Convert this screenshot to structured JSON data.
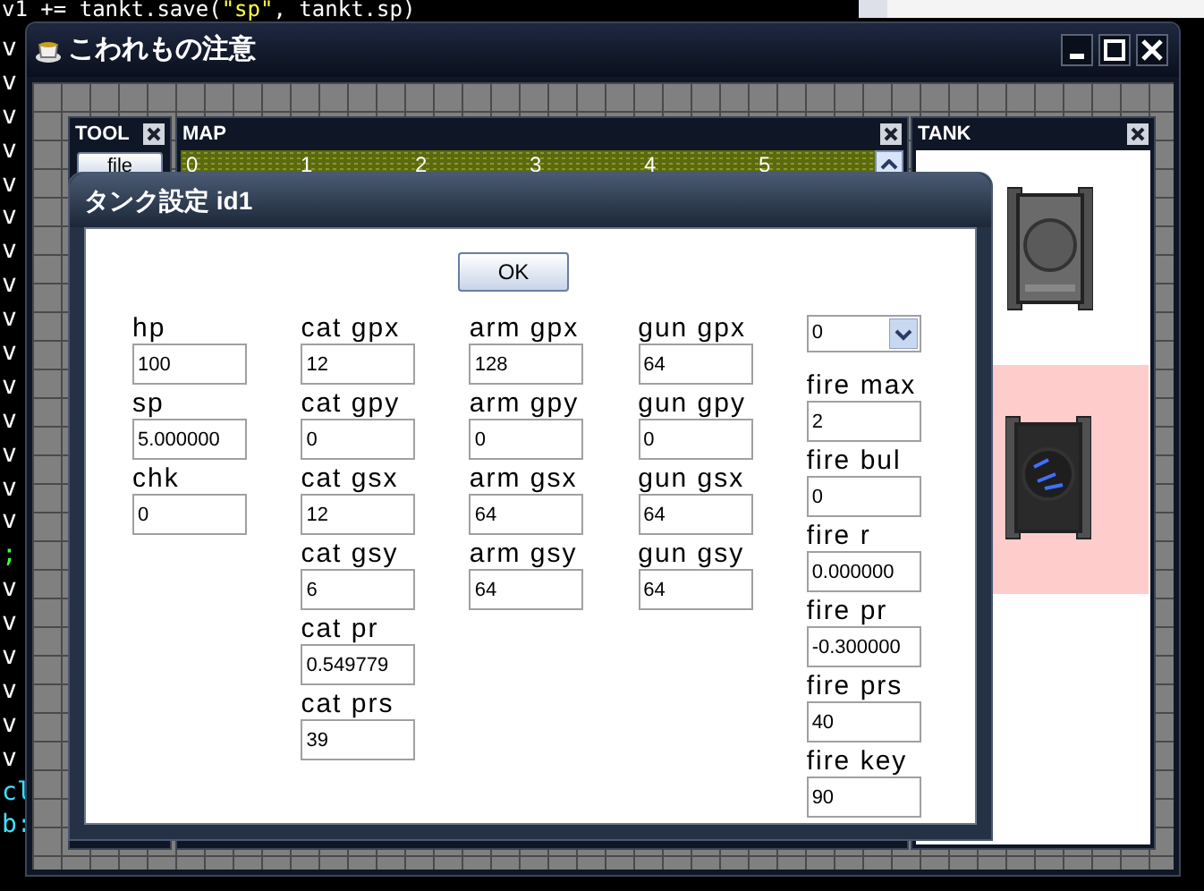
{
  "editor": {
    "lines": [
      {
        "parts": [
          {
            "text": "v1 += tankt.save(",
            "kind": "plain"
          },
          {
            "text": "\"sp\"",
            "kind": "string"
          },
          {
            "text": ", tankt.sp)",
            "kind": "plain"
          }
        ]
      },
      {
        "parts": [
          {
            "text": "v",
            "kind": "plain"
          }
        ]
      },
      {
        "parts": [
          {
            "text": "v",
            "kind": "plain"
          }
        ]
      },
      {
        "parts": [
          {
            "text": "v",
            "kind": "plain"
          }
        ]
      },
      {
        "parts": [
          {
            "text": "v",
            "kind": "plain"
          }
        ]
      },
      {
        "parts": [
          {
            "text": "v",
            "kind": "plain"
          }
        ]
      },
      {
        "parts": [
          {
            "text": "v",
            "kind": "plain"
          }
        ]
      },
      {
        "parts": [
          {
            "text": "v",
            "kind": "plain"
          }
        ]
      },
      {
        "parts": [
          {
            "text": "v",
            "kind": "plain"
          }
        ]
      },
      {
        "parts": [
          {
            "text": "v",
            "kind": "plain"
          }
        ]
      },
      {
        "parts": [
          {
            "text": "v",
            "kind": "plain"
          }
        ]
      },
      {
        "parts": [
          {
            "text": "v",
            "kind": "plain"
          }
        ]
      },
      {
        "parts": [
          {
            "text": "v",
            "kind": "plain"
          }
        ]
      },
      {
        "parts": [
          {
            "text": "v",
            "kind": "plain"
          }
        ]
      },
      {
        "parts": [
          {
            "text": "v",
            "kind": "plain"
          }
        ]
      },
      {
        "parts": [
          {
            "text": "v",
            "kind": "plain"
          }
        ]
      },
      {
        "parts": [
          {
            "text": ";",
            "kind": "punct"
          }
        ]
      },
      {
        "parts": [
          {
            "text": "v",
            "kind": "plain"
          }
        ]
      },
      {
        "parts": [
          {
            "text": "v",
            "kind": "plain"
          }
        ]
      },
      {
        "parts": [
          {
            "text": "v",
            "kind": "plain"
          }
        ]
      },
      {
        "parts": [
          {
            "text": "v",
            "kind": "plain"
          }
        ]
      },
      {
        "parts": [
          {
            "text": "v",
            "kind": "plain"
          }
        ]
      },
      {
        "parts": [
          {
            "text": "v",
            "kind": "plain"
          }
        ]
      },
      {
        "parts": [
          {
            "text": "cl",
            "kind": "ident"
          }
        ]
      },
      {
        "parts": [
          {
            "text": "b:",
            "kind": "ident"
          }
        ]
      }
    ]
  },
  "window": {
    "title": "こわれもの注意"
  },
  "tool_panel": {
    "title": "TOOL",
    "button": "file"
  },
  "map_panel": {
    "title": "MAP",
    "columns": [
      "0",
      "1",
      "2",
      "3",
      "4",
      "5"
    ]
  },
  "tank_panel": {
    "title": "TANK"
  },
  "dialog": {
    "title": "タンク設定 id1",
    "ok": "OK",
    "columns": [
      [
        {
          "kind": "field",
          "label": "hp",
          "value": "100"
        },
        {
          "kind": "field",
          "label": "sp",
          "value": "5.000000"
        },
        {
          "kind": "field",
          "label": "chk",
          "value": "0"
        }
      ],
      [
        {
          "kind": "field",
          "label": "cat gpx",
          "value": "12"
        },
        {
          "kind": "field",
          "label": "cat gpy",
          "value": "0"
        },
        {
          "kind": "field",
          "label": "cat gsx",
          "value": "12"
        },
        {
          "kind": "field",
          "label": "cat gsy",
          "value": "6"
        },
        {
          "kind": "field",
          "label": "cat pr",
          "value": "0.549779"
        },
        {
          "kind": "field",
          "label": "cat prs",
          "value": "39"
        }
      ],
      [
        {
          "kind": "field",
          "label": "arm gpx",
          "value": "128"
        },
        {
          "kind": "field",
          "label": "arm gpy",
          "value": "0"
        },
        {
          "kind": "field",
          "label": "arm gsx",
          "value": "64"
        },
        {
          "kind": "field",
          "label": "arm gsy",
          "value": "64"
        }
      ],
      [
        {
          "kind": "field",
          "label": "gun gpx",
          "value": "64"
        },
        {
          "kind": "field",
          "label": "gun gpy",
          "value": "0"
        },
        {
          "kind": "field",
          "label": "gun gsx",
          "value": "64"
        },
        {
          "kind": "field",
          "label": "gun gsy",
          "value": "64"
        }
      ],
      [
        {
          "kind": "select",
          "value": "0"
        },
        {
          "kind": "field",
          "label": "fire max",
          "value": "2"
        },
        {
          "kind": "field",
          "label": "fire bul",
          "value": "0"
        },
        {
          "kind": "field",
          "label": "fire r",
          "value": "0.000000"
        },
        {
          "kind": "field",
          "label": "fire pr",
          "value": "-0.300000"
        },
        {
          "kind": "field",
          "label": "fire prs",
          "value": "40"
        },
        {
          "kind": "field",
          "label": "fire key",
          "value": "90"
        }
      ]
    ]
  }
}
